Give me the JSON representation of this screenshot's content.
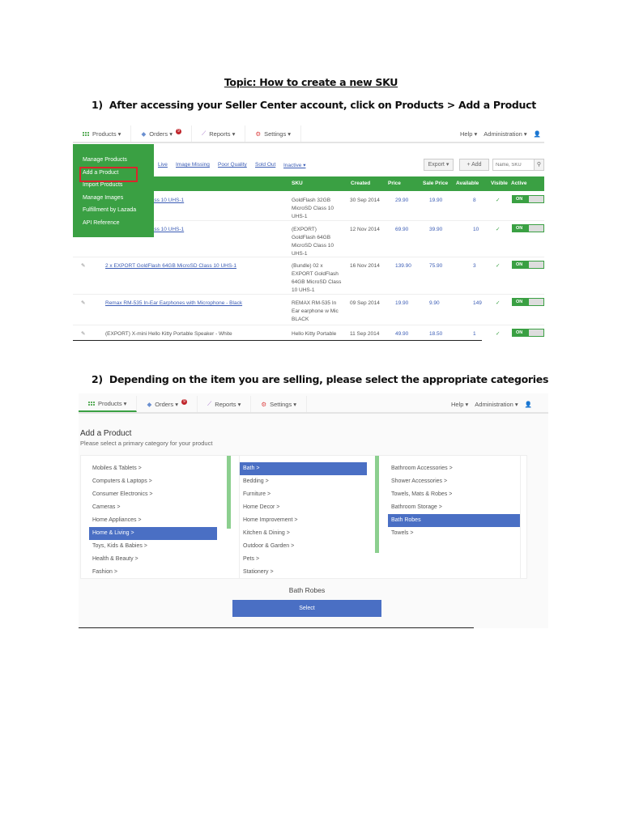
{
  "topic": "Topic: How to create a new SKU",
  "step1": {
    "num": "1)",
    "text": "After accessing your Seller Center account, click on Products > Add a Product"
  },
  "step2": {
    "num": "2)",
    "text": "Depending on the item you are selling, please select the appropriate categories"
  },
  "nav": {
    "products": "Products ▾",
    "orders": "Orders ▾",
    "orders_badge": "9",
    "reports": "Reports ▾",
    "settings": "Settings ▾",
    "help": "Help ▾",
    "admin": "Administration ▾"
  },
  "menu": [
    "Manage Products",
    "Add a Product",
    "Import Products",
    "Manage Images",
    "Fulfillment by Lazada",
    "API Reference"
  ],
  "filters": [
    "Live",
    "Image Missing",
    "Poor Quality",
    "Sold Out",
    "Inactive ▾"
  ],
  "toolbar": {
    "export": "Export ▾",
    "add": "+ Add",
    "search_placeholder": "Name, SKU"
  },
  "columns": [
    "SKU",
    "Created",
    "Price",
    "Sale Price",
    "Available",
    "Visible",
    "Active"
  ],
  "rows": [
    {
      "name": "h 32GB MicroSD Class 10 UHS-1",
      "link": true,
      "sku": "GoldFlash 32GB MicroSD Class 10 UHS-1",
      "created": "30 Sep 2014",
      "price": "29.90",
      "sale": "19.90",
      "available": "8",
      "visible": "✓",
      "active": "ON"
    },
    {
      "name": "h 64GB MicroSD Class 10 UHS-1",
      "link": true,
      "sku": "(EXPORT) GoldFlash 64GB MicroSD Class 10 UHS-1",
      "created": "12 Nov 2014",
      "price": "69.90",
      "sale": "39.90",
      "available": "10",
      "visible": "✓",
      "active": "ON"
    },
    {
      "name": "2 x EXPORT GoldFlash 64GB MicroSD Class 10 UHS-1",
      "link": true,
      "sku": "(Bundle) 02 x EXPORT GoldFlash 64GB MicroSD Class 10 UHS-1",
      "created": "16 Nov 2014",
      "price": "139.90",
      "sale": "75.90",
      "available": "3",
      "visible": "✓",
      "active": "ON"
    },
    {
      "name": "Remax RM-535 In-Ear Earphones with Microphone - Black",
      "link": true,
      "sku": "REMAX RM-535 In Ear earphone w Mic BLACK",
      "created": "09 Sep 2014",
      "price": "19.90",
      "sale": "9.90",
      "available": "149",
      "visible": "✓",
      "active": "ON"
    },
    {
      "name": "(EXPORT) X-mini Hello Kitty Portable Speaker - White",
      "link": false,
      "sku": "Hello Kitty Portable",
      "created": "11 Sep 2014",
      "price": "49.90",
      "sale": "18.50",
      "available": "1",
      "visible": "✓",
      "active": "ON"
    }
  ],
  "add_product": {
    "title": "Add a Product",
    "subtitle": "Please select a primary category for your product",
    "col1": [
      "Mobiles & Tablets >",
      "Computers & Laptops >",
      "Consumer Electronics >",
      "Cameras >",
      "Home Appliances >",
      "Home & Living >",
      "Toys, Kids & Babies >",
      "Health & Beauty >",
      "Fashion >"
    ],
    "col1_sel": 5,
    "col2": [
      "Bath >",
      "Bedding >",
      "Furniture >",
      "Home Decor >",
      "Home Improvement >",
      "Kitchen & Dining >",
      "Outdoor & Garden >",
      "Pets >",
      "Stationery >"
    ],
    "col2_sel": 0,
    "col3": [
      "Bathroom Accessories >",
      "Shower Accessories >",
      "Towels, Mats & Robes >",
      "Bathroom Storage >",
      "Bath Robes",
      "Towels >"
    ],
    "col3_sel": 4,
    "selected": "Bath Robes",
    "select_button": "Select"
  },
  "colors": {
    "green": "#3aa043",
    "blue": "#4a6fc4",
    "red": "#d9262c"
  }
}
